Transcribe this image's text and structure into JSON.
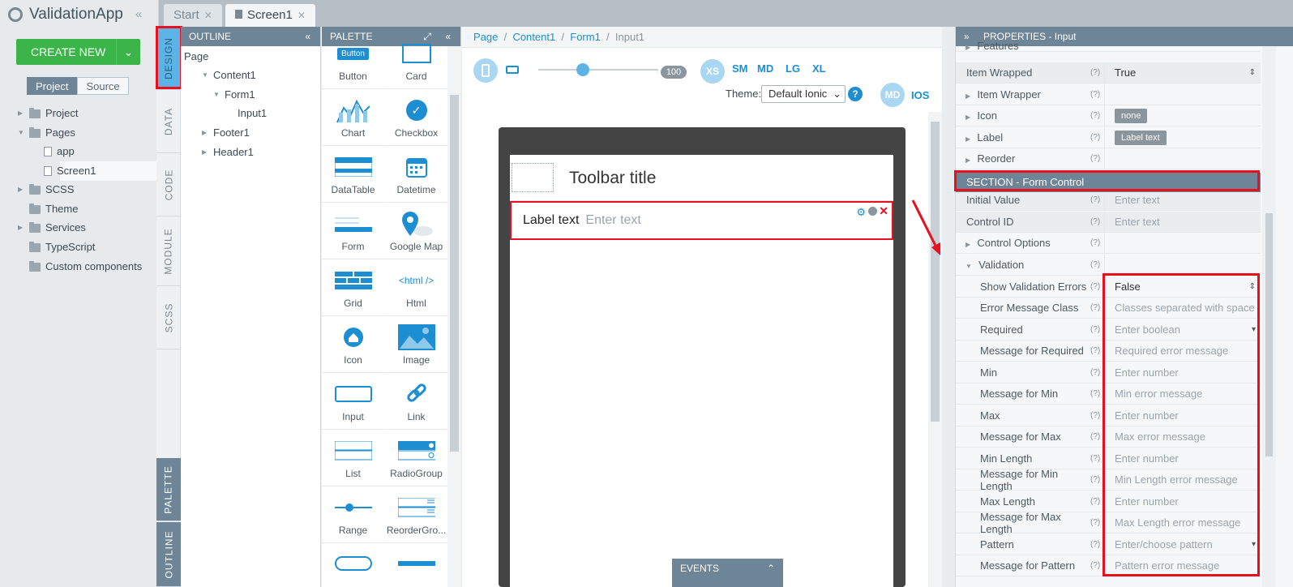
{
  "app": {
    "title": "ValidationApp",
    "create_new": "CREATE NEW"
  },
  "project_tabs": {
    "project": "Project",
    "source": "Source"
  },
  "project_tree": [
    "Project",
    "Pages",
    "app",
    "Screen1",
    "SCSS",
    "Theme",
    "Services",
    "TypeScript",
    "Custom components"
  ],
  "doc_tabs": [
    "Start",
    "Screen1"
  ],
  "side_tabs": {
    "design": "DESIGN",
    "data": "DATA",
    "code": "CODE",
    "module": "MODULE",
    "scss": "SCSS",
    "palette": "PALETTE",
    "outline": "OUTLINE"
  },
  "outline": {
    "header": "OUTLINE",
    "items": [
      "Page",
      "Content1",
      "Form1",
      "Input1",
      "Footer1",
      "Header1"
    ]
  },
  "palette": {
    "header": "PALETTE",
    "items": [
      "Button",
      "Card",
      "Chart",
      "Checkbox",
      "DataTable",
      "Datetime",
      "Form",
      "Google Map",
      "Grid",
      "Html",
      "Icon",
      "Image",
      "Input",
      "Link",
      "List",
      "RadioGroup",
      "Range",
      "ReorderGro..."
    ],
    "button_text": "Button",
    "html_text": "<html />"
  },
  "breadcrumb": [
    "Page",
    "Content1",
    "Form1",
    "Input1"
  ],
  "toolbar": {
    "zoom": "100",
    "sizes": [
      "XS",
      "SM",
      "MD",
      "LG",
      "XL"
    ],
    "theme_label": "Theme:",
    "theme_value": "Default Ionic",
    "mode_md": "MD",
    "mode_ios": "IOS"
  },
  "screen": {
    "toolbar_title": "Toolbar title",
    "label_text": "Label text",
    "input_placeholder": "Enter text"
  },
  "events": "EVENTS",
  "properties": {
    "header": "PROPERTIES - Input",
    "section": "SECTION - Form Control",
    "rows": [
      {
        "name": "Features",
        "value": ""
      },
      {
        "name": "Item Wrapped",
        "value": "True"
      },
      {
        "name": "Item Wrapper",
        "value": ""
      },
      {
        "name": "Icon",
        "value": "none"
      },
      {
        "name": "Label",
        "value": "Label text"
      },
      {
        "name": "Reorder",
        "value": ""
      },
      {
        "name": "Initial Value",
        "value": "Enter text"
      },
      {
        "name": "Control ID",
        "value": "Enter text"
      },
      {
        "name": "Control Options",
        "value": ""
      },
      {
        "name": "Validation",
        "value": ""
      },
      {
        "name": "Show Validation Errors",
        "value": "False"
      },
      {
        "name": "Error Message Class",
        "value": "Classes separated with space"
      },
      {
        "name": "Required",
        "value": "Enter boolean"
      },
      {
        "name": "Message for Required",
        "value": "Required error message"
      },
      {
        "name": "Min",
        "value": "Enter number"
      },
      {
        "name": "Message for Min",
        "value": "Min error message"
      },
      {
        "name": "Max",
        "value": "Enter number"
      },
      {
        "name": "Message for Max",
        "value": "Max error message"
      },
      {
        "name": "Min Length",
        "value": "Enter number"
      },
      {
        "name": "Message for Min Length",
        "value": "Min Length error message"
      },
      {
        "name": "Max Length",
        "value": "Enter number"
      },
      {
        "name": "Message for Max Length",
        "value": "Max Length error message"
      },
      {
        "name": "Pattern",
        "value": "Enter/choose pattern"
      },
      {
        "name": "Message for Pattern",
        "value": "Pattern error message"
      }
    ],
    "help": "(?)"
  },
  "colors": {
    "accent": "#1c8ed1",
    "header": "#6d8596",
    "create": "#3bb54a",
    "highlight": "#e8101c"
  }
}
